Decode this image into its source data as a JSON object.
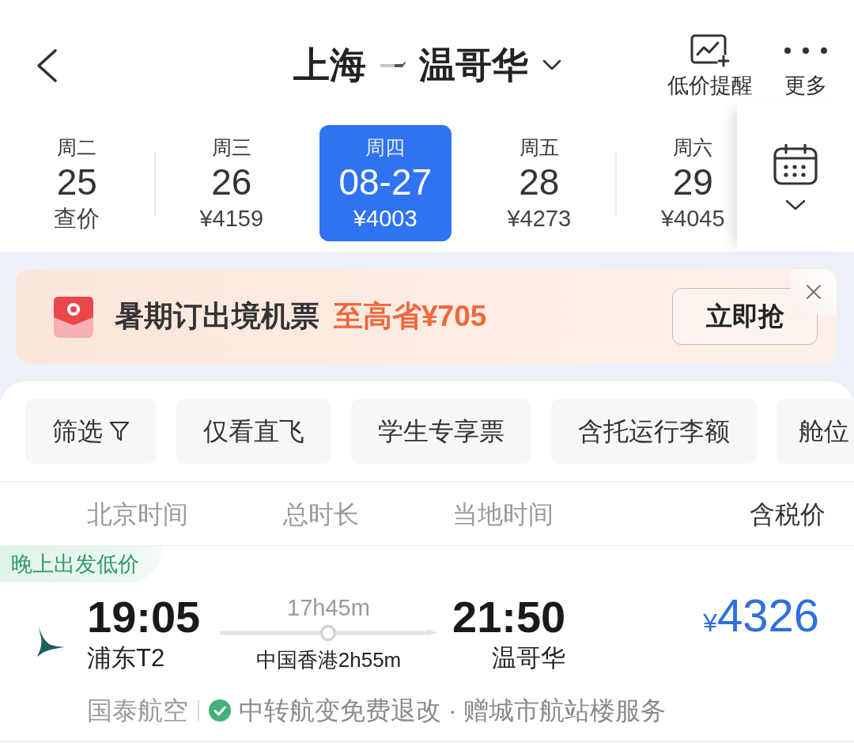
{
  "header": {
    "origin": "上海",
    "destination": "温哥华",
    "actions": [
      {
        "kind": "alert",
        "label": "低价提醒"
      },
      {
        "kind": "more",
        "label": "更多"
      }
    ]
  },
  "dates": [
    {
      "weekday": "周二",
      "date": "25",
      "price": "查价",
      "selected": false
    },
    {
      "weekday": "周三",
      "date": "26",
      "price": "¥4159",
      "selected": false
    },
    {
      "weekday": "周四",
      "date": "08-27",
      "price": "¥4003",
      "selected": true
    },
    {
      "weekday": "周五",
      "date": "28",
      "price": "¥4273",
      "selected": false
    },
    {
      "weekday": "周六",
      "date": "29",
      "price": "¥4045",
      "selected": false
    }
  ],
  "promo": {
    "title": "暑期订出境机票",
    "highlight": "至高省¥705",
    "button": "立即抢"
  },
  "filters": [
    {
      "kind": "filter",
      "label": "筛选"
    },
    {
      "kind": "option",
      "label": "仅看直飞"
    },
    {
      "kind": "option",
      "label": "学生专享票"
    },
    {
      "kind": "option",
      "label": "含托运行李额"
    },
    {
      "kind": "option",
      "label": "舱位"
    }
  ],
  "columns": [
    {
      "label": "北京时间",
      "selected": false
    },
    {
      "label": "总时长",
      "selected": false
    },
    {
      "label": "当地时间",
      "selected": false
    },
    {
      "label": "含税价",
      "selected": true
    }
  ],
  "flights": [
    {
      "tag": "晚上出发低价",
      "depart_time": "19:05",
      "depart_airport": "浦东T2",
      "duration": "17h45m",
      "stopover": "中国香港2h55m",
      "arrive_time": "21:50",
      "arrive_city": "温哥华",
      "currency": "¥",
      "price": "4326",
      "airline": "国泰航空",
      "perks": "中转航变免费退改 · 赠城市航站楼服务"
    }
  ]
}
